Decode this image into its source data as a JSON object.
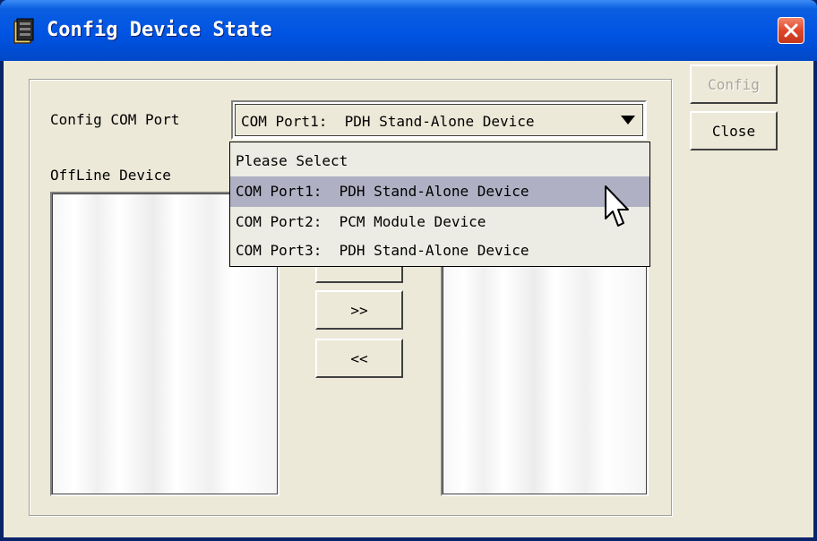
{
  "window": {
    "title": "Config Device State",
    "close_icon": "close-x-icon"
  },
  "buttons": {
    "config": "Config",
    "close": "Close",
    "move_right": ">>",
    "move_left": "<<"
  },
  "labels": {
    "config_com_port": "Config COM Port",
    "offline_device": "OffLine Device"
  },
  "com_port_select": {
    "selected": "COM Port1:  PDH Stand-Alone Device",
    "options": [
      "Please Select",
      "COM Port1:  PDH Stand-Alone Device",
      "COM Port2:  PCM Module Device",
      "COM Port3:  PDH Stand-Alone Device"
    ],
    "highlighted_index": 1
  },
  "colors": {
    "titlebar": "#0054e3",
    "close_button": "#e0462a",
    "dialog_face": "#ece9d8",
    "highlight": "#b0b0c4"
  }
}
